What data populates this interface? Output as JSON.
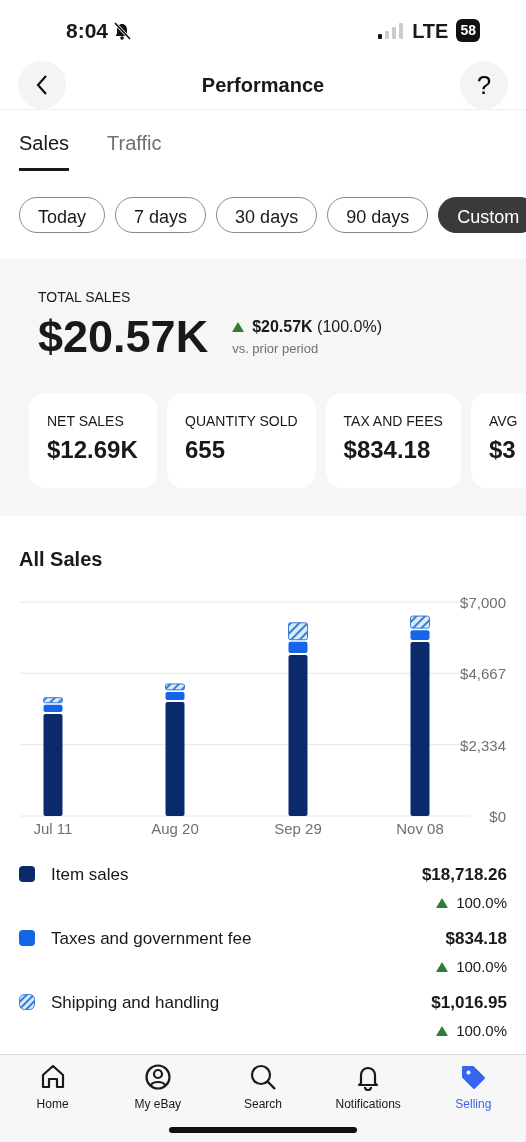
{
  "status_bar": {
    "time": "8:04",
    "network": "LTE",
    "battery": "58"
  },
  "header": {
    "title": "Performance",
    "help": "?"
  },
  "tabs": [
    {
      "label": "Sales",
      "selected": true
    },
    {
      "label": "Traffic",
      "selected": false
    }
  ],
  "ranges": [
    {
      "label": "Today",
      "selected": false
    },
    {
      "label": "7 days",
      "selected": false
    },
    {
      "label": "30 days",
      "selected": false
    },
    {
      "label": "90 days",
      "selected": false
    },
    {
      "label": "Custom",
      "selected": true
    }
  ],
  "total": {
    "label": "TOTAL SALES",
    "value": "$20.57K",
    "change_amount": "$20.57K",
    "change_pct": "(100.0%)",
    "compare": "vs. prior period"
  },
  "metrics": [
    {
      "label": "NET SALES",
      "value": "$12.69K"
    },
    {
      "label": "QUANTITY SOLD",
      "value": "655"
    },
    {
      "label": "TAX AND FEES",
      "value": "$834.18"
    },
    {
      "label": "AVG",
      "value": "$3"
    }
  ],
  "all_sales": {
    "title": "All Sales",
    "chart_data": {
      "type": "bar",
      "stacked": true,
      "categories": [
        "Jul 11",
        "Aug 20",
        "Sep 29",
        "Nov 08"
      ],
      "series": [
        {
          "name": "Item sales",
          "color": "#0a2a6b",
          "values": [
            3340,
            3730,
            5270,
            5690
          ]
        },
        {
          "name": "Taxes and government fee",
          "color": "#1565e8",
          "values": [
            300,
            330,
            430,
            390
          ]
        },
        {
          "name": "Shipping and handling",
          "color": "#3a7bd5",
          "values": [
            230,
            260,
            620,
            460
          ]
        }
      ],
      "ylim": [
        0,
        7000
      ],
      "yticks": [
        {
          "value": 0,
          "label": "$0"
        },
        {
          "value": 2334,
          "label": "$2,334"
        },
        {
          "value": 4667,
          "label": "$4,667"
        },
        {
          "value": 7000,
          "label": "$7,000"
        }
      ]
    },
    "legend": [
      {
        "kind": "solid",
        "amount": "$18,718.26",
        "change": "100.0%"
      },
      {
        "kind": "solid",
        "amount": "$834.18",
        "change": "100.0%"
      },
      {
        "kind": "hatched",
        "amount": "$1,016.95",
        "change": "100.0%"
      }
    ]
  },
  "nav": [
    {
      "label": "Home",
      "selected": false
    },
    {
      "label": "My eBay",
      "selected": false
    },
    {
      "label": "Search",
      "selected": false
    },
    {
      "label": "Notifications",
      "selected": false
    },
    {
      "label": "Selling",
      "selected": true
    }
  ]
}
